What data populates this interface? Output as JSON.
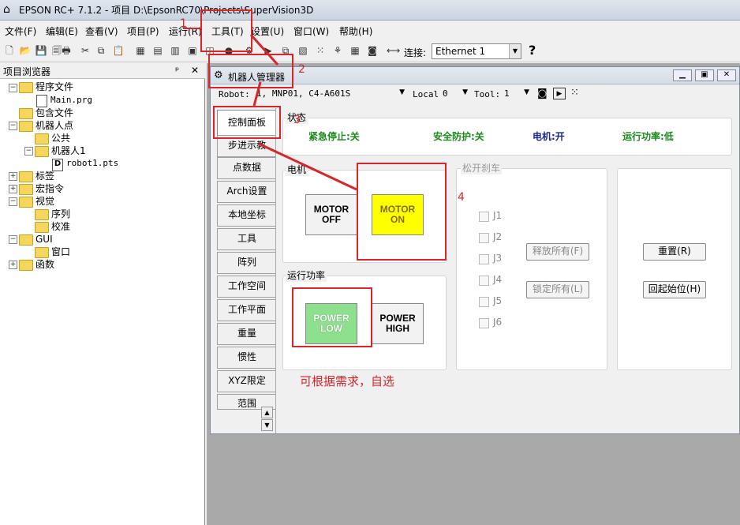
{
  "titlebar": {
    "title": "EPSON RC+ 7.1.2 - 项目 D:\\EpsonRC70\\Projects\\SuperVision3D"
  },
  "menu": [
    "文件(F)",
    "编辑(E)",
    "查看(V)",
    "项目(P)",
    "运行(R)",
    "工具(T)",
    "设置(U)",
    "窗口(W)",
    "帮助(H)"
  ],
  "toolbar": {
    "connect_label": "连接:",
    "connection_value": "Ethernet 1",
    "help": "?"
  },
  "project_browser": {
    "title": "项目浏览器",
    "pin": "ᵖ",
    "close": "✕",
    "tree": {
      "program_files": "程序文件",
      "main_prg": "Main.prg",
      "include_files": "包含文件",
      "robot_points": "机器人点",
      "common": "公共",
      "robot1": "机器人1",
      "robot1_pts": "robot1.pts",
      "labels": "标签",
      "macros": "宏指令",
      "vision": "视觉",
      "sequence": "序列",
      "calibration": "校准",
      "gui": "GUI",
      "window": "窗口",
      "functions": "函数"
    }
  },
  "robot_manager": {
    "title": "机器人管理器",
    "robot_label": "Robot:",
    "robot_value": "1, MNP01, C4-A601S",
    "local_label": "Local",
    "local_value": "0",
    "tool_label": "Tool:",
    "tool_value": "1",
    "tabs": [
      "控制面板",
      "步进示教",
      "点数据",
      "Arch设置",
      "本地坐标",
      "工具",
      "阵列",
      "工作空间",
      "工作平面",
      "重量",
      "惯性",
      "XYZ限定",
      "范围"
    ],
    "status": {
      "label": "状态",
      "estop": "紧急停止:关",
      "safeguard": "安全防护:关",
      "motor": "电机:开",
      "power": "运行功率:低"
    },
    "motor": {
      "label": "电机",
      "off": [
        "MOTOR",
        "OFF"
      ],
      "on": [
        "MOTOR",
        "ON"
      ]
    },
    "power": {
      "label": "运行功率",
      "low": [
        "POWER",
        "LOW"
      ],
      "high": [
        "POWER",
        "HIGH"
      ]
    },
    "brake": {
      "label": "松开刹车",
      "joints": [
        "J1",
        "J2",
        "J3",
        "J4",
        "J5",
        "J6"
      ],
      "release_all": "释放所有(F)",
      "lock_all": "锁定所有(L)"
    },
    "reset": "重置(R)",
    "home": "回起始位(H)"
  },
  "annotations": {
    "n1": "1",
    "n2": "2",
    "n3": "3",
    "n4": "4",
    "note": "可根据需求，自选"
  },
  "colors": {
    "status_green": "#1a8a1a",
    "status_blue": "#1a2a8a",
    "motor_on": "#ffff00",
    "power_low": "#8ee08e",
    "annotation_red": "#d9262a"
  }
}
